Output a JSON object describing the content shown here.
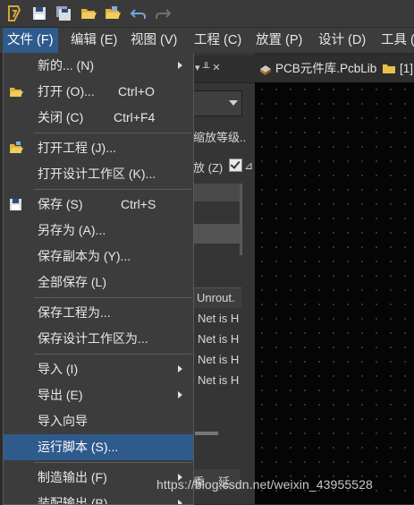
{
  "menubar": {
    "items": [
      {
        "label": "文件 (F)"
      },
      {
        "label": "编辑 (E)"
      },
      {
        "label": "视图 (V)"
      },
      {
        "label": "工程 (C)"
      },
      {
        "label": "放置 (P)"
      },
      {
        "label": "设计 (D)"
      },
      {
        "label": "工具 ("
      }
    ]
  },
  "file_menu": {
    "items": [
      {
        "label": "新的... (N)",
        "shortcut": "",
        "submenu": true
      },
      {
        "label": "打开 (O)...",
        "shortcut": "Ctrl+O",
        "submenu": false
      },
      {
        "label": "关闭 (C)",
        "shortcut": "Ctrl+F4",
        "submenu": false
      },
      {
        "label": "打开工程 (J)...",
        "shortcut": "",
        "submenu": false
      },
      {
        "label": "打开设计工作区 (K)...",
        "shortcut": "",
        "submenu": false
      },
      {
        "label": "保存 (S)",
        "shortcut": "Ctrl+S",
        "submenu": false
      },
      {
        "label": "另存为 (A)...",
        "shortcut": "",
        "submenu": false
      },
      {
        "label": "保存副本为 (Y)...",
        "shortcut": "",
        "submenu": false
      },
      {
        "label": "全部保存 (L)",
        "shortcut": "",
        "submenu": false
      },
      {
        "label": "保存工程为...",
        "shortcut": "",
        "submenu": false
      },
      {
        "label": "保存设计工作区为...",
        "shortcut": "",
        "submenu": false
      },
      {
        "label": "导入 (I)",
        "shortcut": "",
        "submenu": true
      },
      {
        "label": "导出 (E)",
        "shortcut": "",
        "submenu": true
      },
      {
        "label": "导入向导",
        "shortcut": "",
        "submenu": false
      },
      {
        "label": "运行脚本 (S)...",
        "shortcut": "",
        "submenu": false,
        "highlighted": true
      },
      {
        "label": "制造输出 (F)",
        "shortcut": "",
        "submenu": true
      },
      {
        "label": "装配输出 (B)",
        "shortcut": "",
        "submenu": true
      }
    ]
  },
  "document_tabs": [
    {
      "label": "PCB元件库.PcbLib"
    },
    {
      "label": "[1]"
    }
  ],
  "panel": {
    "pin_glyph": "▾ ╨ ✕",
    "zoom_level_label": "缩放等级..",
    "zoom_checkbox_label": "放 (Z)",
    "zoom_checked": true,
    "cut_text": "⊿",
    "column_header": "Unrout.",
    "net_rows": [
      "Net is H",
      "Net is H",
      "Net is H",
      "Net is H"
    ],
    "bottom_tabs": [
      "季",
      "延"
    ]
  },
  "watermark": "https://blog.csdn.net/weixin_43955528",
  "colors": {
    "menu_bg": "#3c3c3c",
    "highlight": "#2f5a8c",
    "canvas": "#050505"
  }
}
